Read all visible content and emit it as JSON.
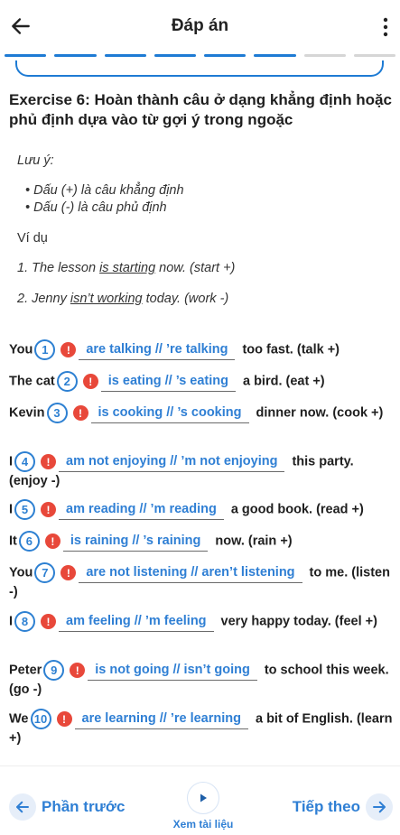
{
  "header": {
    "title": "Đáp án"
  },
  "progress": {
    "completed_segments": 6,
    "total_segments": 8,
    "active_color": "#1e7bd4",
    "inactive_color": "#d6d6d6"
  },
  "exercise": {
    "title": "Exercise 6: Hoàn thành câu ở dạng khẳng định hoặc phủ định dựa vào từ gợi ý trong ngoặc",
    "note_label": "Lưu ý:",
    "note_items": [
      "Dấu (+) là câu khẳng định",
      "Dấu (-) là câu phủ định"
    ],
    "example_label": "Ví dụ",
    "examples": [
      {
        "pre": "1. The lesson ",
        "ans": "is starting",
        "post": " now. (start +)"
      },
      {
        "pre": "2. Jenny ",
        "ans": "isn’t working",
        "post": " today. (work -)"
      }
    ],
    "questions": [
      {
        "pre": "You",
        "num": "1",
        "answer": "are talking // ’re talking",
        "post": "too fast. (talk +)"
      },
      {
        "pre": "The cat",
        "num": "2",
        "answer": "is eating // ’s eating",
        "post": "a bird. (eat +)"
      },
      {
        "pre": "Kevin",
        "num": "3",
        "answer": "is cooking // ’s cooking",
        "post": "dinner now. (cook +)"
      },
      {
        "pre": "I",
        "num": "4",
        "answer": "am not enjoying // ’m not enjoying",
        "post": "this party. (enjoy -)"
      },
      {
        "pre": "I",
        "num": "5",
        "answer": "am reading // ’m reading",
        "post": "a good book. (read +)"
      },
      {
        "pre": "It",
        "num": "6",
        "answer": "is raining // ’s raining",
        "post": "now. (rain +)"
      },
      {
        "pre": "You",
        "num": "7",
        "answer": "are not listening // aren’t listening",
        "post": "to me. (listen -)"
      },
      {
        "pre": "I",
        "num": "8",
        "answer": "am feeling // ’m feeling",
        "post": "very happy today. (feel +)"
      },
      {
        "pre": "Peter",
        "num": "9",
        "answer": "is not going // isn’t going",
        "post": "to school this week. (go -)"
      },
      {
        "pre": "We",
        "num": "10",
        "answer": "are learning // ’re learning",
        "post": "a bit of English. (learn +)"
      }
    ]
  },
  "footer": {
    "prev_label": "Phần trước",
    "doc_label": "Xem tài liệu",
    "next_label": "Tiếp theo"
  },
  "icons": {
    "back": "arrow-left-icon",
    "menu": "more-vertical-icon",
    "warn": "exclamation-circle-icon",
    "play": "play-icon",
    "prev": "arrow-left-icon",
    "next": "arrow-right-icon"
  }
}
